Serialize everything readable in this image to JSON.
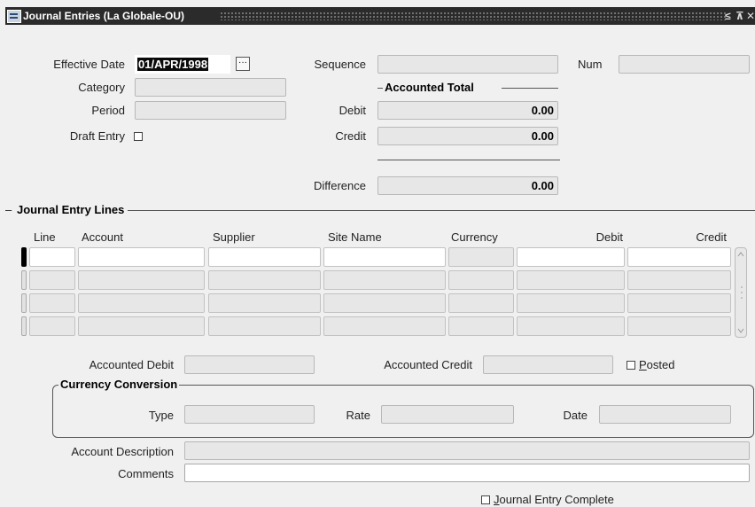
{
  "window": {
    "title": "Journal Entries (La Globale-OU)",
    "controls": [
      "≤",
      "⊼",
      "✕"
    ]
  },
  "header": {
    "effective_date_label": "Effective Date",
    "effective_date_value": "01/APR/1998",
    "category_label": "Category",
    "category_value": "",
    "period_label": "Period",
    "period_value": "",
    "draft_entry_label": "Draft Entry",
    "sequence_label": "Sequence",
    "sequence_value": "",
    "num_label": "Num",
    "num_value": "",
    "accounted_total_label": "Accounted Total",
    "debit_label": "Debit",
    "debit_value": "0.00",
    "credit_label": "Credit",
    "credit_value": "0.00",
    "difference_label": "Difference",
    "difference_value": "0.00"
  },
  "lines": {
    "section_title": "Journal Entry Lines",
    "columns": [
      "Line",
      "Account",
      "Supplier",
      "Site Name",
      "Currency",
      "Debit",
      "Credit"
    ]
  },
  "footer": {
    "accounted_debit_label": "Accounted Debit",
    "accounted_debit_value": "",
    "accounted_credit_label": "Accounted Credit",
    "accounted_credit_value": "",
    "posted_label_first": "P",
    "posted_label_rest": "osted",
    "currency_conversion_title": "Currency Conversion",
    "type_label": "Type",
    "rate_label": "Rate",
    "date_label": "Date",
    "account_description_label": "Account Description",
    "comments_label": "Comments",
    "journal_complete_first": "J",
    "journal_complete_rest": "ournal Entry Complete"
  }
}
